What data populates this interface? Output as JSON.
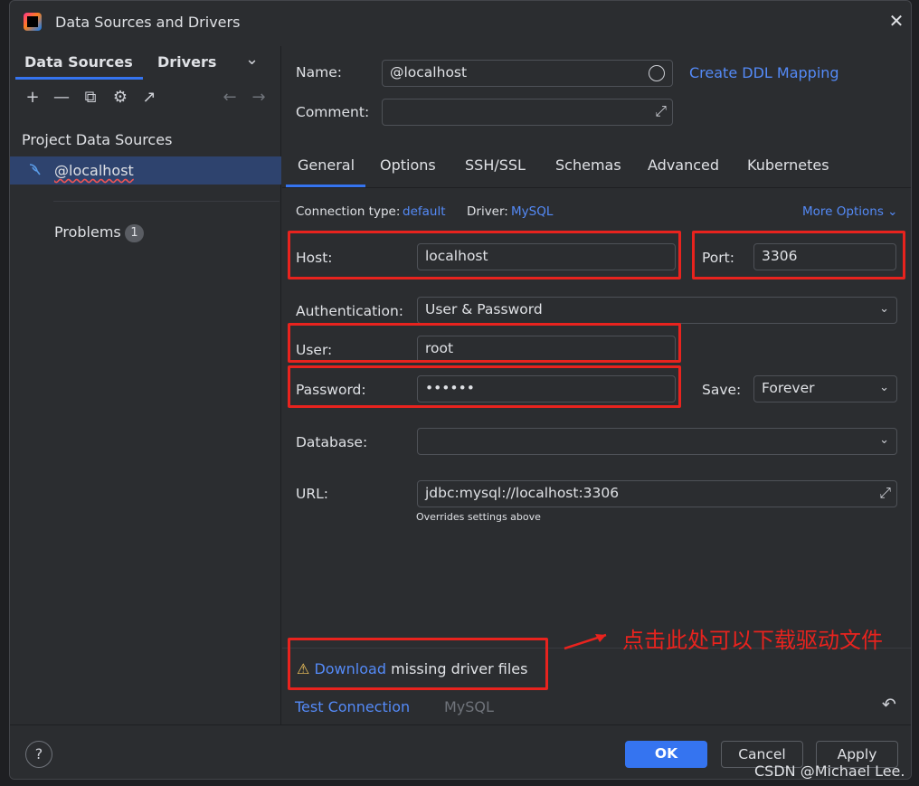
{
  "window": {
    "title": "Data Sources and Drivers",
    "close_glyph": "✕"
  },
  "left": {
    "tabs": [
      "Data Sources",
      "Drivers"
    ],
    "tabs_dropdown_glyph": "⌄",
    "toolbar": {
      "add": "+",
      "remove": "—",
      "copy": "⧉",
      "settings": "⚙",
      "jump": "↗",
      "back": "←",
      "forward": "→"
    },
    "section_title": "Project Data Sources",
    "data_source": {
      "name": "@localhost",
      "icon": "dolphin-icon"
    },
    "problems": {
      "label": "Problems",
      "count": "1"
    }
  },
  "form": {
    "name_label": "Name:",
    "name_value": "@localhost",
    "create_ddl_mapping": "Create DDL Mapping",
    "comment_label": "Comment:",
    "comment_value": "",
    "tabs": [
      "General",
      "Options",
      "SSH/SSL",
      "Schemas",
      "Advanced",
      "Kubernetes"
    ],
    "connection_type_label": "Connection type:",
    "connection_type_value": "default",
    "driver_label": "Driver:",
    "driver_value": "MySQL",
    "more_options": "More Options",
    "host_label": "Host:",
    "host_value": "localhost",
    "port_label": "Port:",
    "port_value": "3306",
    "auth_label": "Authentication:",
    "auth_value": "User & Password",
    "user_label": "User:",
    "user_value": "root",
    "password_label": "Password:",
    "password_value": "••••••",
    "save_label": "Save:",
    "save_value": "Forever",
    "database_label": "Database:",
    "database_value": "",
    "url_label": "URL:",
    "url_value": "jdbc:mysql://localhost:3306",
    "url_hint": "Overrides settings above"
  },
  "driver_warning": {
    "icon": "warning-icon",
    "link": "Download",
    "text": "missing driver files"
  },
  "bottom_links": {
    "test_connection": "Test Connection",
    "driver_name": "MySQL",
    "revert_glyph": "↶"
  },
  "footer": {
    "help": "?",
    "ok": "OK",
    "cancel": "Cancel",
    "apply": "Apply"
  },
  "annotation": {
    "text": "点击此处可以下载驱动文件",
    "color": "#e8231e"
  },
  "watermark": "CSDN @Michael Lee.",
  "colors": {
    "accent": "#3574f0",
    "link": "#548af7",
    "selection": "#2e436e",
    "annotation_red": "#e8231e",
    "background": "#2b2d30"
  }
}
